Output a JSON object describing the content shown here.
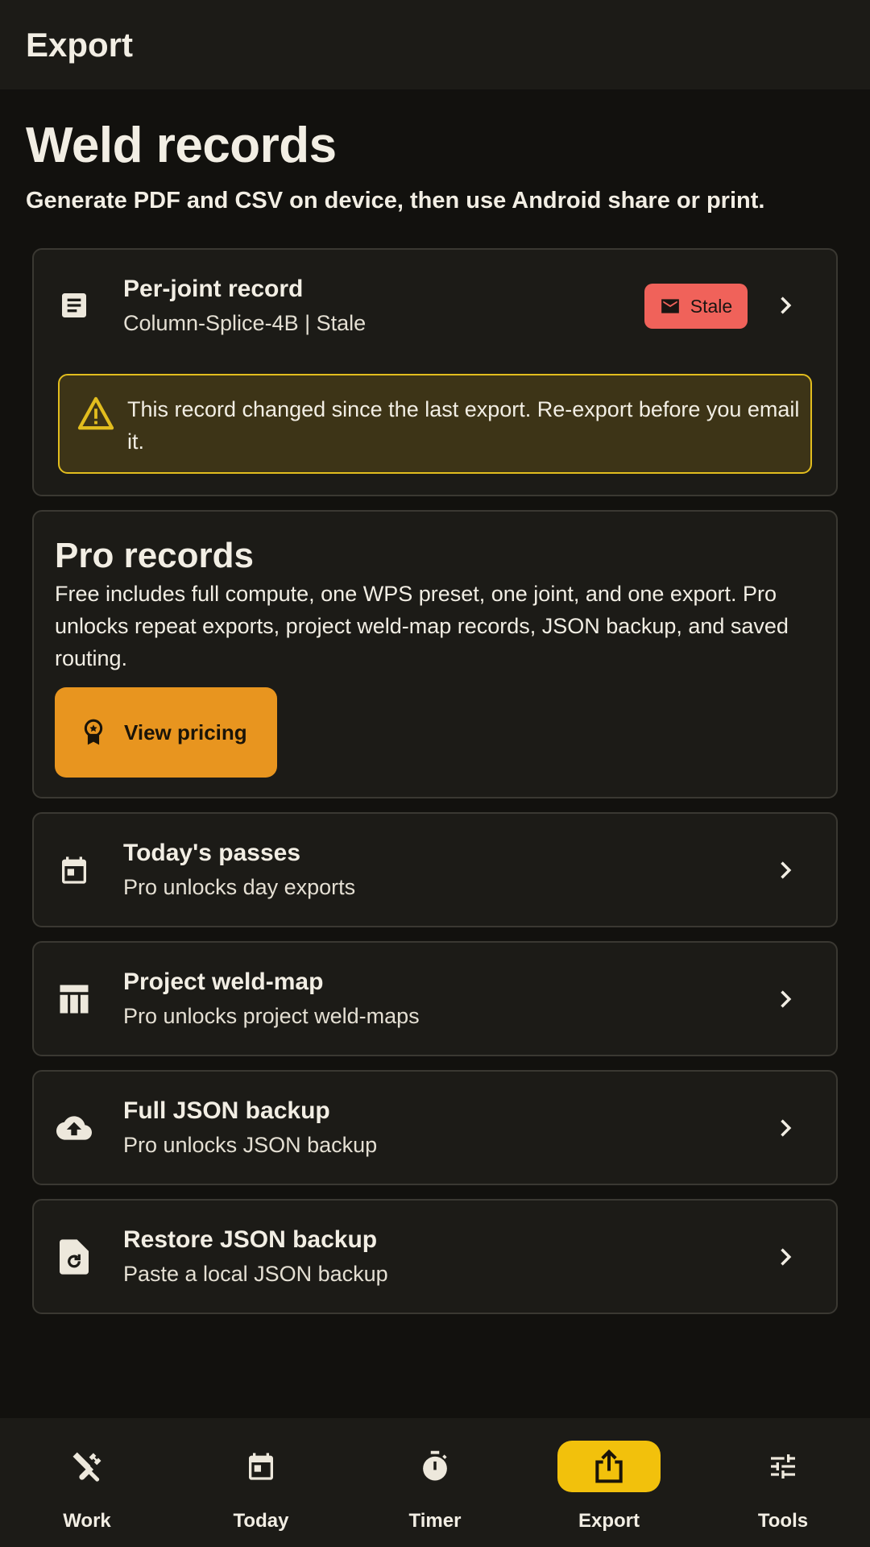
{
  "app_bar": {
    "title": "Export"
  },
  "header": {
    "title": "Weld records",
    "subtitle": "Generate PDF and CSV on device, then use Android share or print."
  },
  "per_joint": {
    "title": "Per-joint record",
    "subtitle": "Column-Splice-4B | Stale",
    "badge": "Stale",
    "warning": "This record changed since the last export. Re-export before you email it."
  },
  "pro": {
    "title": "Pro records",
    "body": "Free includes full compute, one WPS preset, one joint, and one export. Pro unlocks repeat exports, project weld-map records, JSON backup, and saved routing.",
    "button_label": "View pricing"
  },
  "rows": [
    {
      "title": "Today's passes",
      "subtitle": "Pro unlocks day exports",
      "icon": "calendar-icon"
    },
    {
      "title": "Project weld-map",
      "subtitle": "Pro unlocks project weld-maps",
      "icon": "table-icon"
    },
    {
      "title": "Full JSON backup",
      "subtitle": "Pro unlocks JSON backup",
      "icon": "cloud-upload-icon"
    },
    {
      "title": "Restore JSON backup",
      "subtitle": "Paste a local JSON backup",
      "icon": "file-restore-icon"
    }
  ],
  "nav": [
    {
      "label": "Work",
      "icon": "tools-icon",
      "active": false
    },
    {
      "label": "Today",
      "icon": "calendar-today-icon",
      "active": false
    },
    {
      "label": "Timer",
      "icon": "timer-icon",
      "active": false
    },
    {
      "label": "Export",
      "icon": "share-icon",
      "active": true
    },
    {
      "label": "Tools",
      "icon": "sliders-icon",
      "active": false
    }
  ],
  "colors": {
    "background": "#12110e",
    "surface": "#1c1b17",
    "accent": "#f2c10c",
    "pricing_button": "#e8951f",
    "stale_badge": "#f0625a",
    "warning_border": "#e2bd1e",
    "warning_fill": "#3d3417"
  }
}
